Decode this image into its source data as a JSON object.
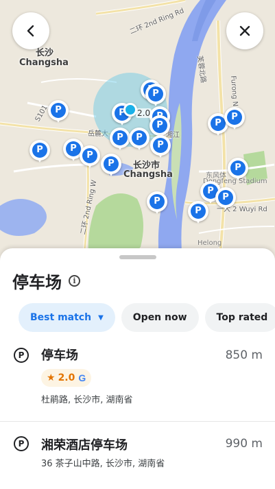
{
  "map": {
    "city_west_cn": "长沙",
    "city_west_en": "Changsha",
    "city_center_cn": "长沙市",
    "city_center_en": "Changsha",
    "road_2nd_ring": "二环 2nd Ring Rd",
    "road_furong_cn": "芙蓉北路",
    "road_furong_en": "Furong N",
    "road_s101": "S101",
    "label_yuelu": "岳麓大",
    "label_xiangjiang": "湘江",
    "label_dongfeng_cn": "东风体",
    "label_dongfeng_en": "Dongfeng Stadium",
    "road_wuyi": "一大 2 Wuyi Rd",
    "road_ring_w": "二环 2nd Ring W",
    "label_helong": "Helong",
    "user_rating_bubble": "2.0",
    "pin_glyph": "P",
    "pin_color": "#1a73e8",
    "water_color": "#8fa8f0",
    "park_color": "#b5d99c"
  },
  "buttons": {
    "back_icon": "arrow-left-icon",
    "close_icon": "close-icon"
  },
  "sheet": {
    "title": "停车场",
    "info_icon_glyph": "i",
    "filters": [
      {
        "label": "Best match",
        "active": true
      },
      {
        "label": "Open now",
        "active": false
      },
      {
        "label": "Top rated",
        "active": false
      }
    ],
    "results": [
      {
        "icon": "parking-icon",
        "icon_glyph": "P",
        "name": "停车场",
        "distance": "850 m",
        "rating": "2.0",
        "rating_source": "G",
        "address": "杜鹃路, 长沙市, 湖南省"
      },
      {
        "icon": "parking-icon",
        "icon_glyph": "P",
        "name": "湘荣酒店停车场",
        "distance": "990 m",
        "address": "36 茶子山中路, 长沙市, 湖南省"
      }
    ]
  }
}
